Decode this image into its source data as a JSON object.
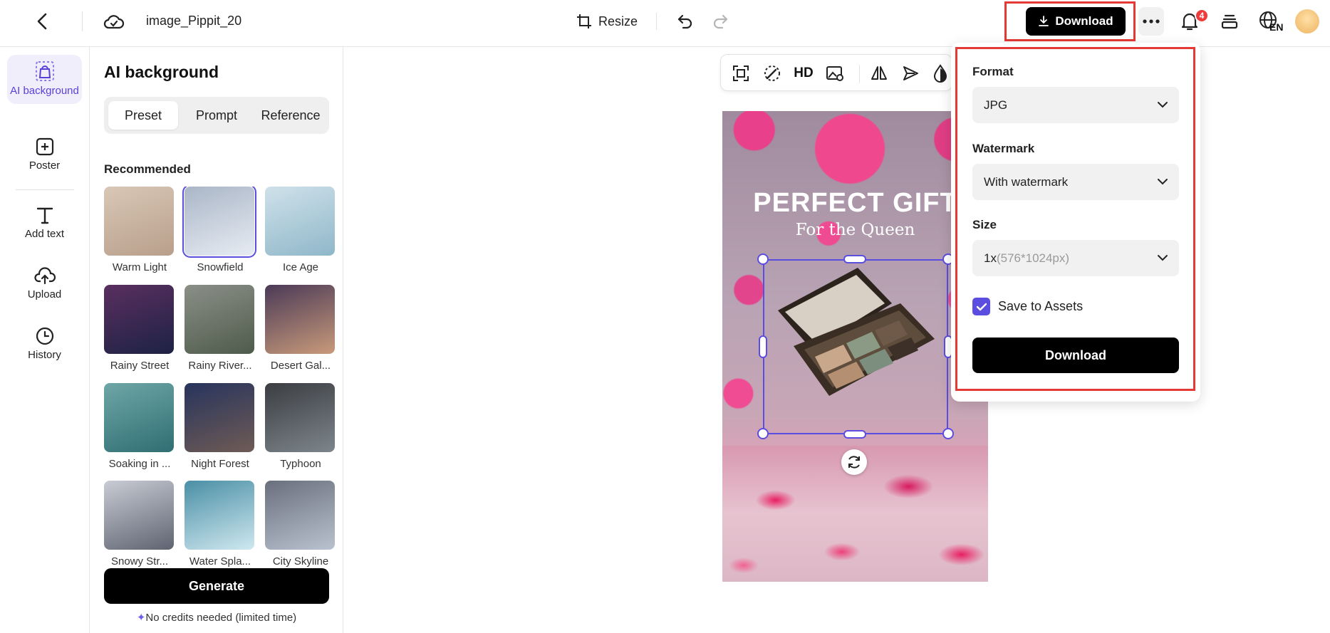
{
  "header": {
    "file_name": "image_Pippit_20",
    "resize_label": "Resize",
    "download_label": "Download",
    "notification_count": "4",
    "language": "EN",
    "icons": [
      "back-icon",
      "cloud-sync-icon",
      "resize-icon",
      "undo-icon",
      "redo-icon",
      "download-icon",
      "more-icon",
      "bell-icon",
      "layers-icon",
      "globe-icon"
    ]
  },
  "rail": {
    "items": [
      {
        "label": "AI background",
        "icon": "ai-background-icon",
        "active": true
      },
      {
        "label": "Poster",
        "icon": "poster-icon"
      },
      {
        "label": "Add text",
        "icon": "text-icon"
      },
      {
        "label": "Upload",
        "icon": "upload-icon"
      },
      {
        "label": "History",
        "icon": "history-icon"
      }
    ]
  },
  "panel": {
    "title": "AI background",
    "tabs": [
      {
        "label": "Preset",
        "active": true
      },
      {
        "label": "Prompt"
      },
      {
        "label": "Reference"
      }
    ],
    "section_title": "Recommended",
    "presets": [
      {
        "label": "Warm Light",
        "colors": [
          "#d9c7b6",
          "#b89f8b"
        ]
      },
      {
        "label": "Snowfield",
        "colors": [
          "#aab6c7",
          "#e7ecf3"
        ],
        "selected": true
      },
      {
        "label": "Ice Age",
        "colors": [
          "#cfe1ea",
          "#8fb7c9"
        ]
      },
      {
        "label": "Rainy Street",
        "colors": [
          "#5a2f5f",
          "#1d2244"
        ]
      },
      {
        "label": "Rainy River...",
        "colors": [
          "#8b8f87",
          "#4e5b4b"
        ]
      },
      {
        "label": "Desert Gal...",
        "colors": [
          "#4b3a57",
          "#c89a7a"
        ]
      },
      {
        "label": "Soaking in ...",
        "colors": [
          "#6fa6a6",
          "#2f6e73"
        ]
      },
      {
        "label": "Night Forest",
        "colors": [
          "#27345d",
          "#6f5b55"
        ]
      },
      {
        "label": "Typhoon",
        "colors": [
          "#3b3d41",
          "#7d858c"
        ]
      },
      {
        "label": "Snowy Str...",
        "colors": [
          "#c9ccd4",
          "#5f6371"
        ]
      },
      {
        "label": "Water Spla...",
        "colors": [
          "#4a8fa6",
          "#cfe8ef"
        ]
      },
      {
        "label": "City Skyline",
        "colors": [
          "#6a6f7d",
          "#b9c2cf"
        ]
      }
    ],
    "generate_label": "Generate",
    "credits_note": "No credits needed (limited time)"
  },
  "canvas": {
    "toolbar_icons": [
      "cutout-icon",
      "magic-edit-icon",
      "hd-icon",
      "replace-image-icon",
      "flip-icon",
      "send-icon",
      "opacity-icon"
    ],
    "hd_label": "HD",
    "poster_title": "PERFECT GIFT",
    "poster_subtitle": "For the Queen"
  },
  "download_popup": {
    "format_label": "Format",
    "format_value": "JPG",
    "watermark_label": "Watermark",
    "watermark_value": "With watermark",
    "size_label": "Size",
    "size_value": "1x",
    "size_detail": "(576*1024px)",
    "save_label": "Save to Assets",
    "save_checked": true,
    "download_label": "Download"
  },
  "colors": {
    "accent": "#5b4de0",
    "highlight": "#e53935",
    "primary_button": "#000000"
  }
}
